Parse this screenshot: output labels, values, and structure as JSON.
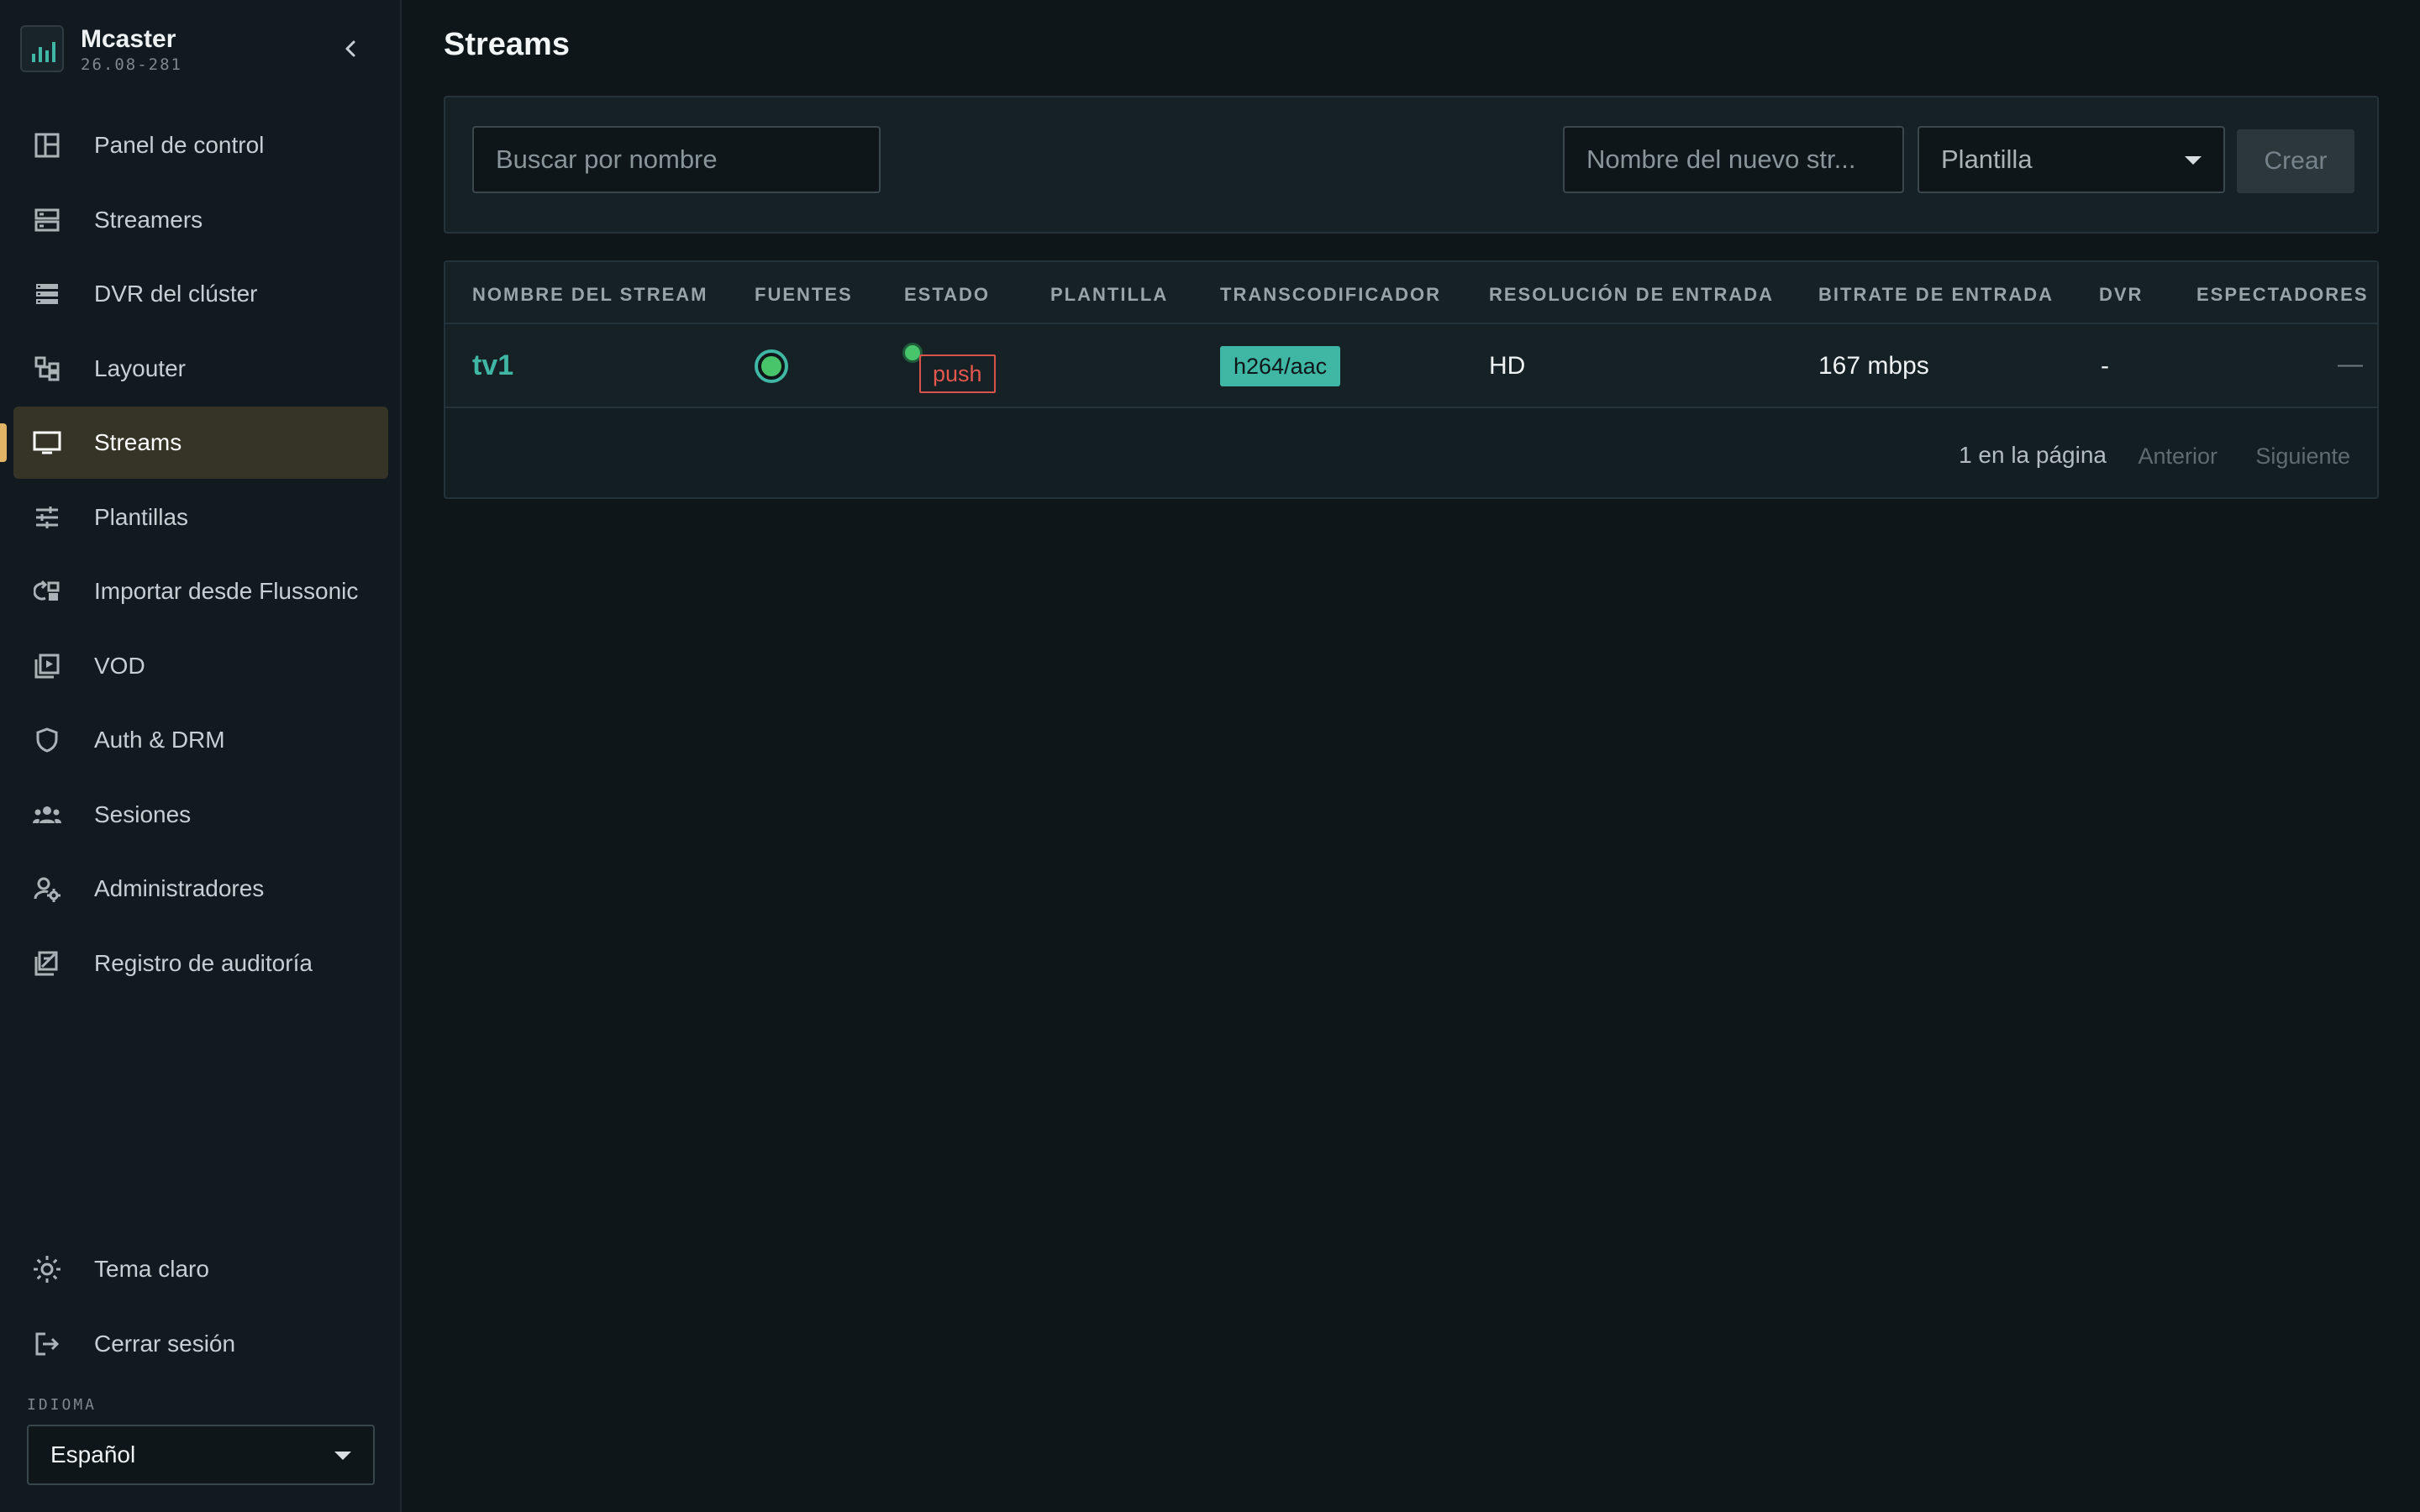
{
  "app": {
    "name": "Mcaster",
    "version": "26.08-281"
  },
  "sidebar": {
    "items": [
      {
        "label": "Panel de control",
        "icon": "dashboard-icon",
        "active": false
      },
      {
        "label": "Streamers",
        "icon": "server-icon",
        "active": false
      },
      {
        "label": "DVR del clúster",
        "icon": "storage-icon",
        "active": false
      },
      {
        "label": "Layouter",
        "icon": "layout-icon",
        "active": false
      },
      {
        "label": "Streams",
        "icon": "monitor-icon",
        "active": true
      },
      {
        "label": "Plantillas",
        "icon": "sliders-icon",
        "active": false
      },
      {
        "label": "Importar desde Flussonic",
        "icon": "import-icon",
        "active": false
      },
      {
        "label": "VOD",
        "icon": "video-library-icon",
        "active": false
      },
      {
        "label": "Auth & DRM",
        "icon": "shield-icon",
        "active": false
      },
      {
        "label": "Sesiones",
        "icon": "users-icon",
        "active": false
      },
      {
        "label": "Administradores",
        "icon": "user-gear-icon",
        "active": false
      },
      {
        "label": "Registro de auditoría",
        "icon": "audit-log-icon",
        "active": false
      }
    ],
    "bottom": [
      {
        "label": "Tema claro",
        "icon": "sun-icon"
      },
      {
        "label": "Cerrar sesión",
        "icon": "logout-icon"
      }
    ],
    "language_label": "IDIOMA",
    "language_value": "Español"
  },
  "main": {
    "title": "Streams",
    "search_placeholder": "Buscar por nombre",
    "new_stream_placeholder": "Nombre del nuevo str...",
    "template_select": "Plantilla",
    "create_label": "Crear",
    "columns": [
      "NOMBRE DEL STREAM",
      "FUENTES",
      "ESTADO",
      "PLANTILLA",
      "TRANSCODIFICADOR",
      "RESOLUCIÓN DE ENTRADA",
      "BITRATE DE ENTRADA",
      "DVR",
      "ESPECTADORES"
    ],
    "rows": [
      {
        "name": "tv1",
        "status": "push",
        "template": "",
        "transcoder": "h264/aac",
        "resolution": "HD",
        "bitrate": "167 mbps",
        "dvr": "-",
        "viewers": "—"
      }
    ],
    "pager": {
      "count": "1 en la página",
      "prev": "Anterior",
      "next": "Siguiente"
    }
  },
  "colors": {
    "accent": "#3fb7a4",
    "active_marker": "#e2b566",
    "status_ok": "#48c46b",
    "status_push": "#e3574c"
  }
}
